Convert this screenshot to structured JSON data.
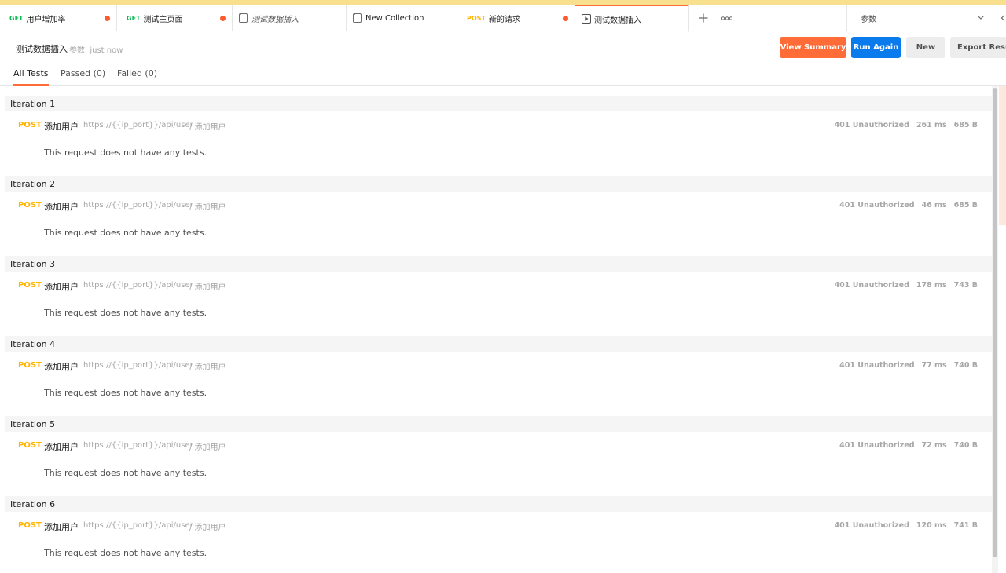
{
  "tabs": [
    {
      "method": "GET",
      "title": "用户增加率",
      "unsaved": true
    },
    {
      "method": "GET",
      "title": "测试主页面",
      "unsaved": true
    },
    {
      "icon": "collection-icon",
      "title": "测试数据插入",
      "italic": true
    },
    {
      "icon": "collection-icon",
      "title": "New Collection"
    },
    {
      "method": "POST",
      "title": "新的请求",
      "unsaved": true
    },
    {
      "icon": "runner-icon",
      "title": "测试数据插入",
      "active": true
    }
  ],
  "environment": {
    "selected": "参数"
  },
  "header": {
    "title": "测试数据插入",
    "meta": "参数, just now",
    "view_summary_label": "View Summary",
    "run_again_label": "Run Again",
    "new_label": "New",
    "export_label": "Export Results"
  },
  "filters": {
    "all": "All Tests",
    "passed": "Passed (0)",
    "failed": "Failed (0)"
  },
  "iterations": [
    {
      "label": "Iteration 1",
      "method": "POST",
      "name": "添加用户",
      "url": "https://{{ip_port}}/api/user",
      "path": "/ 添加用户",
      "status": "401 Unauthorized",
      "time": "261 ms",
      "size": "685 B",
      "note": "This request does not have any tests."
    },
    {
      "label": "Iteration 2",
      "method": "POST",
      "name": "添加用户",
      "url": "https://{{ip_port}}/api/user",
      "path": "/ 添加用户",
      "status": "401 Unauthorized",
      "time": "46 ms",
      "size": "685 B",
      "note": "This request does not have any tests."
    },
    {
      "label": "Iteration 3",
      "method": "POST",
      "name": "添加用户",
      "url": "https://{{ip_port}}/api/user",
      "path": "/ 添加用户",
      "status": "401 Unauthorized",
      "time": "178 ms",
      "size": "743 B",
      "note": "This request does not have any tests."
    },
    {
      "label": "Iteration 4",
      "method": "POST",
      "name": "添加用户",
      "url": "https://{{ip_port}}/api/user",
      "path": "/ 添加用户",
      "status": "401 Unauthorized",
      "time": "77 ms",
      "size": "740 B",
      "note": "This request does not have any tests."
    },
    {
      "label": "Iteration 5",
      "method": "POST",
      "name": "添加用户",
      "url": "https://{{ip_port}}/api/user",
      "path": "/ 添加用户",
      "status": "401 Unauthorized",
      "time": "72 ms",
      "size": "740 B",
      "note": "This request does not have any tests."
    },
    {
      "label": "Iteration 6",
      "method": "POST",
      "name": "添加用户",
      "url": "https://{{ip_port}}/api/user",
      "path": "/ 添加用户",
      "status": "401 Unauthorized",
      "time": "120 ms",
      "size": "741 B",
      "note": "This request does not have any tests."
    }
  ],
  "colors": {
    "accent": "#ff6c37",
    "primary": "#097bed",
    "get": "#0cbb52",
    "post": "#ffb400",
    "unsaved_dot": "#ff5b2e"
  }
}
